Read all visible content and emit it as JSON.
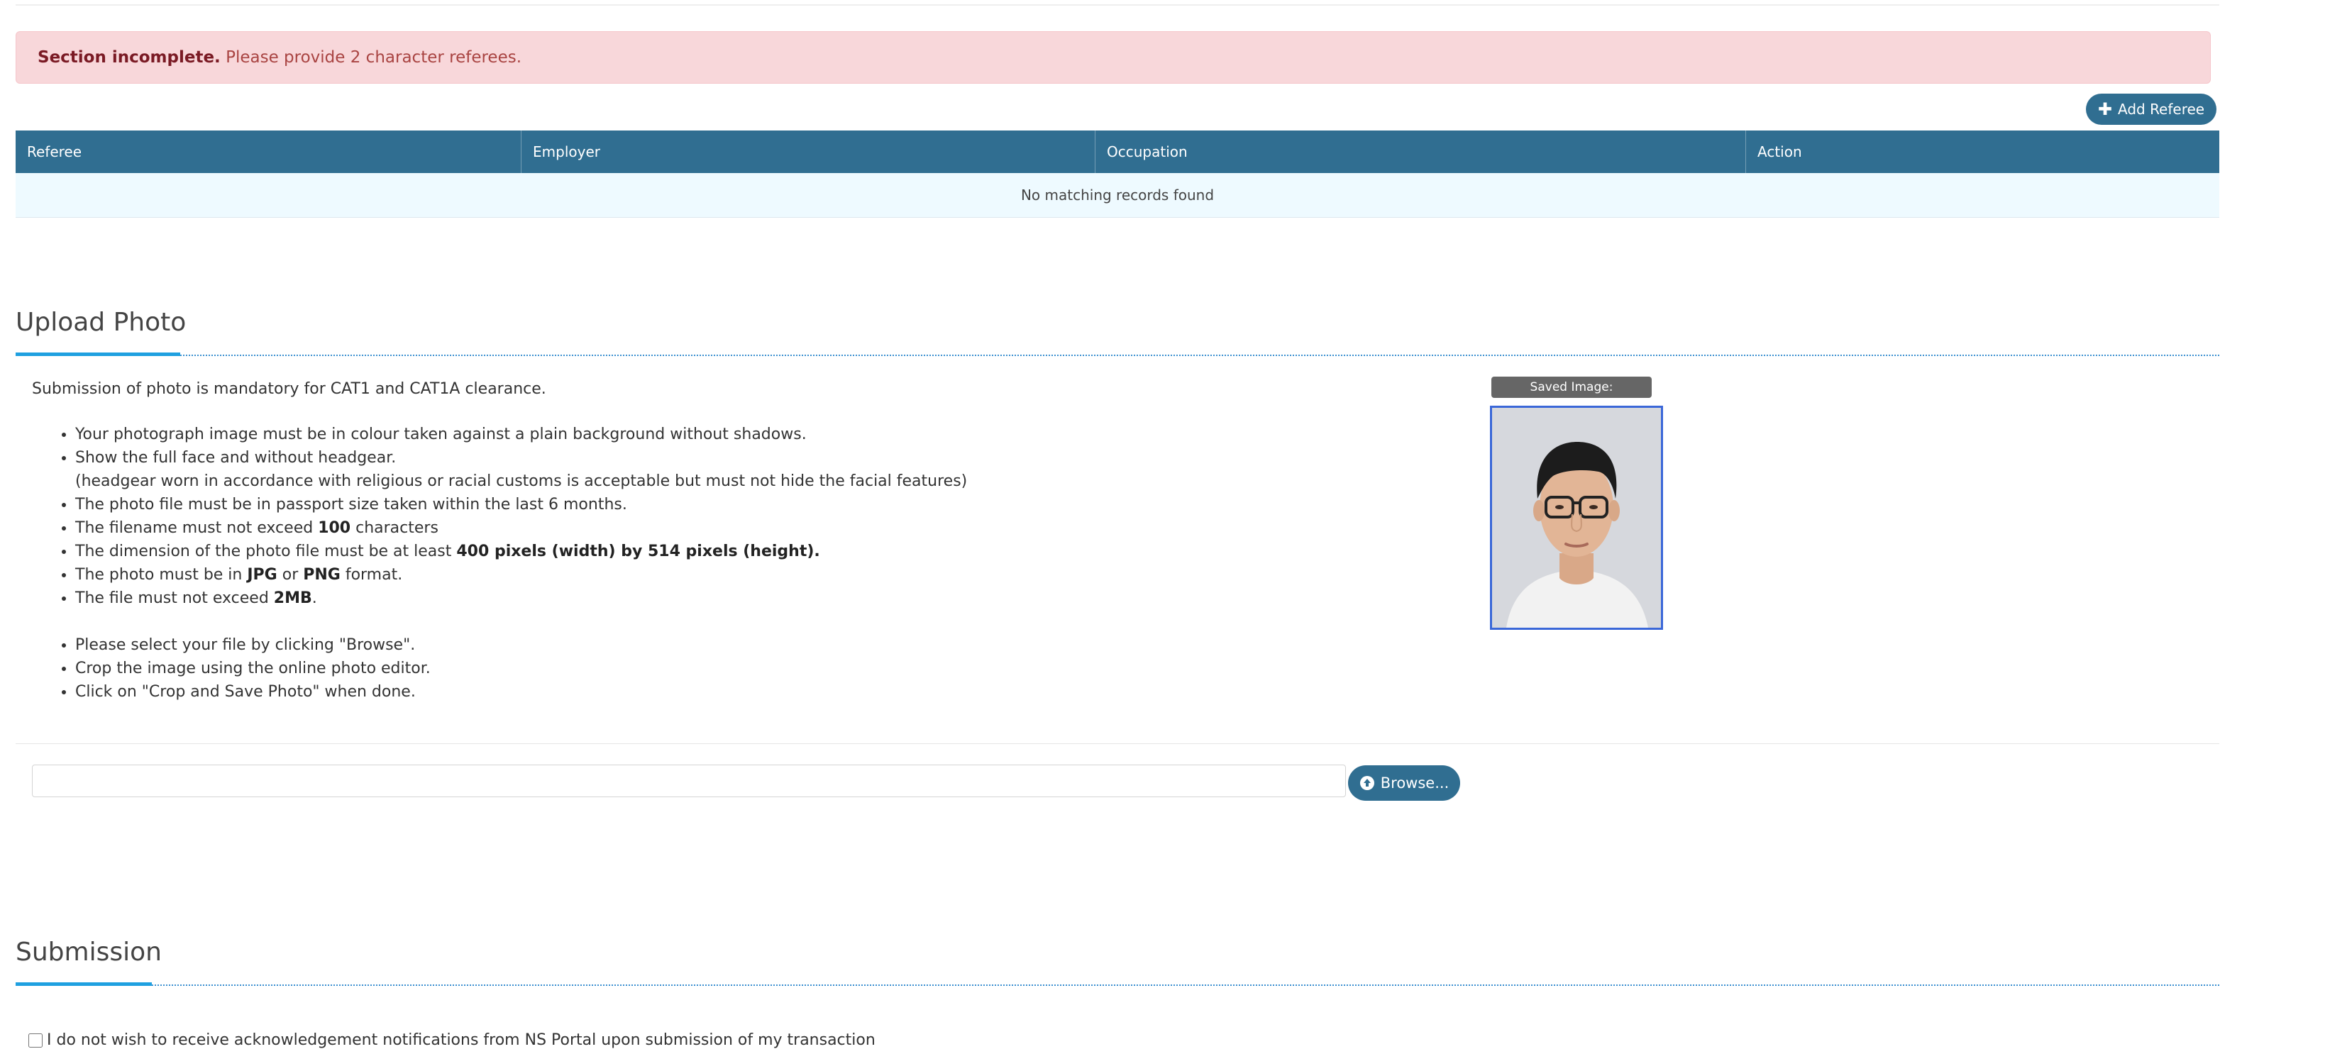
{
  "alert": {
    "strong": "Section incomplete.",
    "text": " Please provide 2 character referees."
  },
  "referees": {
    "add_button_label": "Add Referee",
    "add_icon": "plus-icon",
    "columns": [
      "Referee",
      "Employer",
      "Occupation",
      "Action"
    ],
    "empty_message": "No matching records found"
  },
  "upload_photo": {
    "title": "Upload Photo",
    "intro": "Submission of photo is mandatory for CAT1 and CAT1A clearance.",
    "requirements": [
      {
        "pre": "Your photograph image must be in colour taken against a plain background without shadows."
      },
      {
        "pre": "Show the full face and without headgear.",
        "note": "(headgear worn in accordance with religious or racial customs is acceptable but must not hide the facial features)"
      },
      {
        "pre": "The photo file must be in passport size taken within the last 6 months."
      },
      {
        "pre": "The filename must not exceed ",
        "b1": "100",
        "post": " characters"
      },
      {
        "pre": "The dimension of the photo file must be at least ",
        "b1": "400 pixels (width) by 514 pixels (height)."
      },
      {
        "pre": "The photo must be in ",
        "b1": "JPG",
        "mid": " or ",
        "b2": "PNG",
        "post": " format."
      },
      {
        "pre": "The file must not exceed ",
        "b1": "2MB",
        "post": "."
      }
    ],
    "instructions": [
      "Please select your file by clicking \"Browse\".",
      "Crop the image using the online photo editor.",
      "Click on \"Crop and Save Photo\" when done."
    ],
    "saved_image_label": "Saved Image:",
    "file_input_value": "",
    "browse_label": "Browse...",
    "browse_icon": "upload-circle-icon"
  },
  "submission": {
    "title": "Submission",
    "opt_out_label": "I do not wish to receive acknowledgement notifications from NS Portal upon submission of my transaction"
  },
  "colors": {
    "primary": "#306e91",
    "alert_bg": "#f8d7da",
    "accent": "#1fa0e0"
  }
}
